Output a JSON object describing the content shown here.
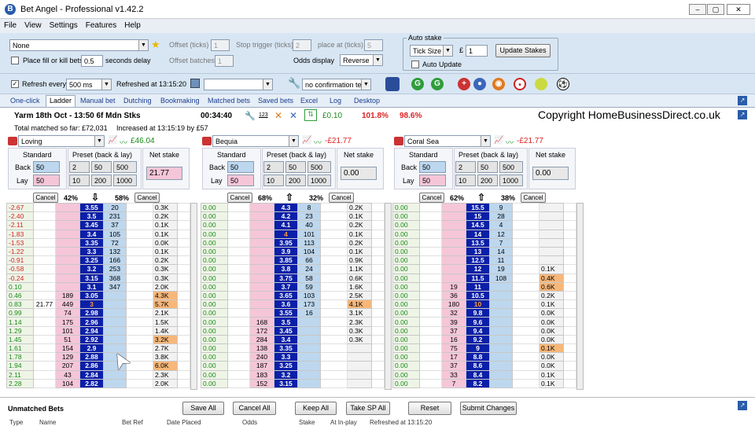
{
  "window": {
    "title": "Bet Angel - Professional v1.42.2",
    "min": "–",
    "max": "▢",
    "close": "✕"
  },
  "menu": [
    "File",
    "View",
    "Settings",
    "Features",
    "Help"
  ],
  "toolbar": {
    "strategy": "None",
    "offset_label": "Offset (ticks)",
    "offset_value": "1",
    "stop_label": "Stop trigger (ticks)",
    "stop_value": "2",
    "place_label": "place at (ticks)",
    "place_value": "5",
    "place_fill_label": "Place fill or kill bets",
    "place_fill_value": "0.5",
    "seconds_delay": "seconds delay",
    "offset_batches_label": "Offset batches",
    "offset_batches_value": "1",
    "odds_display_label": "Odds display",
    "odds_display_value": "Reverse",
    "auto_stake_title": "Auto stake",
    "tick_size": "Tick Size",
    "currency": "£",
    "stake_value": "1",
    "update_stakes": "Update Stakes",
    "auto_update": "Auto Update",
    "refresh_label": "Refresh every",
    "refresh_value": "500 ms",
    "refreshed_at": "Refreshed at 13:15:20",
    "confirmation": "no confirmation tes"
  },
  "tabs": [
    "One-click",
    "Ladder",
    "Manual bet",
    "Dutching",
    "Bookmaking",
    "Matched bets",
    "Saved bets",
    "Excel",
    "Log",
    "Desktop"
  ],
  "market": {
    "name": "Yarm 18th Oct - 13:50 6f Mdn Stks",
    "countdown": "00:34:40",
    "badge_123": "123",
    "profit": "£0.10",
    "book_back": "101.8%",
    "book_lay": "98.6%",
    "copyright": "Copyright HomeBusinessDirect.co.uk",
    "matched": "Total matched so far: £72,031",
    "increased": "Increased at 13:15:19 by £57"
  },
  "labels": {
    "standard": "Standard",
    "preset": "Preset (back & lay)",
    "net_stake": "Net stake",
    "back": "Back",
    "lay": "Lay",
    "cancel": "Cancel"
  },
  "panels": [
    {
      "selection": "Loving",
      "pl": "£46.04",
      "pl_color": "#1a8a1a",
      "back_std": "50",
      "lay_std": "50",
      "preset_back": [
        "2",
        "50",
        "500"
      ],
      "preset_lay": [
        "10",
        "200",
        "1000"
      ],
      "net": "21.77",
      "net_color": "#f5c6d8",
      "back_pct": "42%",
      "lay_pct": "58%",
      "arrow": "⇩",
      "rows": [
        [
          "-2.67",
          "",
          "",
          "3.55",
          "20",
          "",
          "0.3K",
          ""
        ],
        [
          "-2.40",
          "",
          "",
          "3.5",
          "231",
          "",
          "0.2K",
          ""
        ],
        [
          "-2.11",
          "",
          "",
          "3.45",
          "37",
          "",
          "0.1K",
          ""
        ],
        [
          "-1.83",
          "",
          "",
          "3.4",
          "105",
          "",
          "0.1K",
          ""
        ],
        [
          "-1.53",
          "",
          "",
          "3.35",
          "72",
          "",
          "0.0K",
          ""
        ],
        [
          "-1.22",
          "",
          "",
          "3.3",
          "132",
          "",
          "0.1K",
          ""
        ],
        [
          "-0.91",
          "",
          "",
          "3.25",
          "166",
          "",
          "0.2K",
          ""
        ],
        [
          "-0.58",
          "",
          "",
          "3.2",
          "253",
          "",
          "0.3K",
          ""
        ],
        [
          "-0.24",
          "",
          "",
          "3.15",
          "368",
          "",
          "0.3K",
          ""
        ],
        [
          "0.10",
          "",
          "",
          "3.1",
          "347",
          "",
          "2.0K",
          ""
        ],
        [
          "0.46",
          "",
          "189",
          "3.05",
          "",
          "",
          "4.3K",
          "hl"
        ],
        [
          "0.83",
          "21.77",
          "449",
          "3",
          "",
          "",
          "5.7K",
          "hl"
        ],
        [
          "0.99",
          "",
          "74",
          "2.98",
          "",
          "",
          "2.1K",
          ""
        ],
        [
          "1.14",
          "",
          "175",
          "2.96",
          "",
          "",
          "1.5K",
          ""
        ],
        [
          "1.29",
          "",
          "101",
          "2.94",
          "",
          "",
          "1.4K",
          ""
        ],
        [
          "1.45",
          "",
          "51",
          "2.92",
          "",
          "",
          "3.2K",
          "hl"
        ],
        [
          "1.61",
          "",
          "154",
          "2.9",
          "",
          "",
          "2.7K",
          ""
        ],
        [
          "1.78",
          "",
          "129",
          "2.88",
          "",
          "",
          "3.8K",
          ""
        ],
        [
          "1.94",
          "",
          "207",
          "2.86",
          "",
          "",
          "6.0K",
          "hl"
        ],
        [
          "2.11",
          "",
          "43",
          "2.84",
          "",
          "",
          "2.3K",
          ""
        ],
        [
          "2.28",
          "",
          "104",
          "2.82",
          "",
          "",
          "2.0K",
          ""
        ]
      ]
    },
    {
      "selection": "Bequia",
      "pl": "-£21.77",
      "pl_color": "#d22",
      "back_std": "50",
      "lay_std": "50",
      "preset_back": [
        "2",
        "50",
        "500"
      ],
      "preset_lay": [
        "10",
        "200",
        "1000"
      ],
      "net": "0.00",
      "net_color": "#e8e8e8",
      "back_pct": "68%",
      "lay_pct": "32%",
      "arrow": "⇧",
      "rows": [
        [
          "0.00",
          "",
          "",
          "4.3",
          "8",
          "",
          "0.2K",
          ""
        ],
        [
          "0.00",
          "",
          "",
          "4.2",
          "23",
          "",
          "0.1K",
          ""
        ],
        [
          "0.00",
          "",
          "",
          "4.1",
          "40",
          "",
          "0.2K",
          ""
        ],
        [
          "0.00",
          "",
          "",
          "4",
          "101",
          "",
          "0.1K",
          ""
        ],
        [
          "0.00",
          "",
          "",
          "3.95",
          "113",
          "",
          "0.2K",
          ""
        ],
        [
          "0.00",
          "",
          "",
          "3.9",
          "104",
          "",
          "0.1K",
          ""
        ],
        [
          "0.00",
          "",
          "",
          "3.85",
          "66",
          "",
          "0.9K",
          ""
        ],
        [
          "0.00",
          "",
          "",
          "3.8",
          "24",
          "",
          "1.1K",
          ""
        ],
        [
          "0.00",
          "",
          "",
          "3.75",
          "58",
          "",
          "0.6K",
          ""
        ],
        [
          "0.00",
          "",
          "",
          "3.7",
          "59",
          "",
          "1.6K",
          ""
        ],
        [
          "0.00",
          "",
          "",
          "3.65",
          "103",
          "",
          "2.5K",
          ""
        ],
        [
          "0.00",
          "",
          "",
          "3.6",
          "173",
          "",
          "4.1K",
          "hl"
        ],
        [
          "0.00",
          "",
          "",
          "3.55",
          "16",
          "",
          "3.1K",
          ""
        ],
        [
          "0.00",
          "",
          "168",
          "3.5",
          "",
          "",
          "2.3K",
          ""
        ],
        [
          "0.00",
          "",
          "172",
          "3.45",
          "",
          "",
          "0.3K",
          ""
        ],
        [
          "0.00",
          "",
          "284",
          "3.4",
          "",
          "",
          "0.3K",
          ""
        ],
        [
          "0.00",
          "",
          "138",
          "3.35",
          "",
          "",
          "",
          ""
        ],
        [
          "0.00",
          "",
          "240",
          "3.3",
          "",
          "",
          "",
          ""
        ],
        [
          "0.00",
          "",
          "187",
          "3.25",
          "",
          "",
          "",
          ""
        ],
        [
          "0.00",
          "",
          "183",
          "3.2",
          "",
          "",
          "",
          ""
        ],
        [
          "0.00",
          "",
          "152",
          "3.15",
          "",
          "",
          "",
          ""
        ]
      ]
    },
    {
      "selection": "Coral Sea",
      "pl": "-£21.77",
      "pl_color": "#d22",
      "back_std": "50",
      "lay_std": "50",
      "preset_back": [
        "2",
        "50",
        "500"
      ],
      "preset_lay": [
        "10",
        "200",
        "1000"
      ],
      "net": "0.00",
      "net_color": "#e8e8e8",
      "back_pct": "62%",
      "lay_pct": "38%",
      "arrow": "⇧",
      "rows": [
        [
          "0.00",
          "",
          "",
          "15.5",
          "9",
          "",
          "",
          ""
        ],
        [
          "0.00",
          "",
          "",
          "15",
          "28",
          "",
          "",
          ""
        ],
        [
          "0.00",
          "",
          "",
          "14.5",
          "4",
          "",
          "",
          ""
        ],
        [
          "0.00",
          "",
          "",
          "14",
          "12",
          "",
          "",
          ""
        ],
        [
          "0.00",
          "",
          "",
          "13.5",
          "7",
          "",
          "",
          ""
        ],
        [
          "0.00",
          "",
          "",
          "13",
          "14",
          "",
          "",
          ""
        ],
        [
          "0.00",
          "",
          "",
          "12.5",
          "11",
          "",
          "",
          ""
        ],
        [
          "0.00",
          "",
          "",
          "12",
          "19",
          "",
          "0.1K",
          ""
        ],
        [
          "0.00",
          "",
          "",
          "11.5",
          "108",
          "",
          "0.4K",
          "hl"
        ],
        [
          "0.00",
          "",
          "19",
          "11",
          "",
          "",
          "0.6K",
          "hl"
        ],
        [
          "0.00",
          "",
          "36",
          "10.5",
          "",
          "",
          "0.2K",
          ""
        ],
        [
          "0.00",
          "",
          "180",
          "10",
          "",
          "",
          "0.1K",
          ""
        ],
        [
          "0.00",
          "",
          "32",
          "9.8",
          "",
          "",
          "0.0K",
          ""
        ],
        [
          "0.00",
          "",
          "39",
          "9.6",
          "",
          "",
          "0.0K",
          ""
        ],
        [
          "0.00",
          "",
          "37",
          "9.4",
          "",
          "",
          "0.0K",
          ""
        ],
        [
          "0.00",
          "",
          "16",
          "9.2",
          "",
          "",
          "0.0K",
          ""
        ],
        [
          "0.00",
          "",
          "75",
          "9",
          "",
          "",
          "0.1K",
          "hl"
        ],
        [
          "0.00",
          "",
          "17",
          "8.8",
          "",
          "",
          "0.0K",
          ""
        ],
        [
          "0.00",
          "",
          "37",
          "8.6",
          "",
          "",
          "0.0K",
          ""
        ],
        [
          "0.00",
          "",
          "33",
          "8.4",
          "",
          "",
          "0.1K",
          ""
        ],
        [
          "0.00",
          "",
          "7",
          "8.2",
          "",
          "",
          "0.1K",
          ""
        ]
      ]
    }
  ],
  "orange_prices": {
    "0": "3",
    "1": "4",
    "2": "10"
  },
  "unmatched": {
    "title": "Unmatched Bets",
    "buttons": [
      "Save All",
      "Cancel All",
      "Keep All",
      "Take SP All",
      "Reset",
      "Submit Changes"
    ],
    "columns": [
      "Type",
      "Name",
      "Bet Ref",
      "Date Placed",
      "Odds",
      "Stake",
      "At In-play",
      "Refreshed at 13:15:20"
    ]
  }
}
